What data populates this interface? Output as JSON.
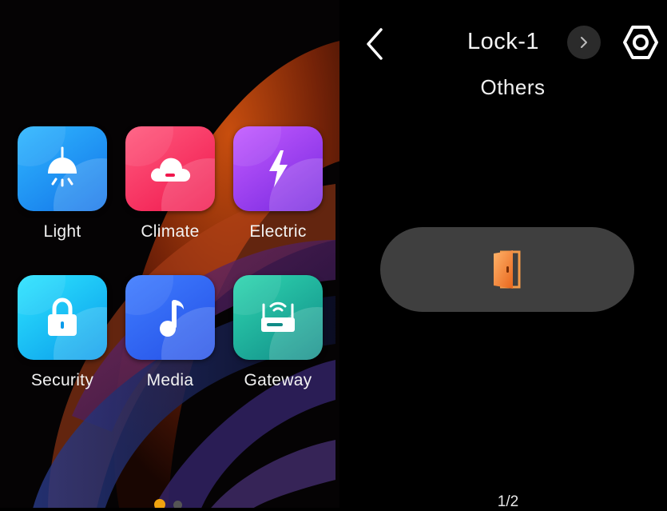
{
  "home": {
    "apps": [
      {
        "label": "Light",
        "icon": "lightbulb-icon",
        "color": "#1f8ff5"
      },
      {
        "label": "Climate",
        "icon": "cloud-icon",
        "color": "#f83463"
      },
      {
        "label": "Electric",
        "icon": "lightning-bolt-icon",
        "color": "#9a3ff0"
      },
      {
        "label": "Security",
        "icon": "padlock-icon",
        "color": "#18bdf5"
      },
      {
        "label": "Media",
        "icon": "music-note-icon",
        "color": "#3166f2"
      },
      {
        "label": "Gateway",
        "icon": "router-icon",
        "color": "#1fae9a"
      }
    ],
    "page_dots": {
      "total": 2,
      "active": 1,
      "active_color": "#f1a30f"
    }
  },
  "device": {
    "title": "Lock-1",
    "subtitle": "Others",
    "page_indicator": "1/2",
    "accent": "#f0862a"
  }
}
